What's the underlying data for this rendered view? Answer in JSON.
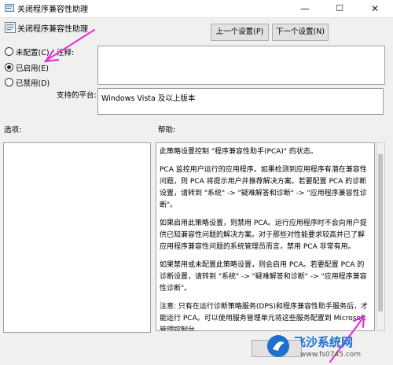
{
  "window": {
    "title": "关闭程序兼容性助理",
    "minimize": "—",
    "maximize": "☐",
    "close": "✕"
  },
  "header": {
    "policy_title": "关闭程序兼容性助理",
    "prev_button": "上一个设置(P)",
    "next_button": "下一个设置(N)"
  },
  "options": [
    {
      "label": "未配置(C)",
      "selected": false
    },
    {
      "label": "已启用(E)",
      "selected": true
    },
    {
      "label": "已禁用(D)",
      "selected": false
    }
  ],
  "comment": {
    "label": "注释:",
    "value": ""
  },
  "platform": {
    "label": "支持的平台:",
    "value": "Windows Vista 及以上版本"
  },
  "sections": {
    "options_label": "选项:",
    "help_label": "帮助:"
  },
  "help": {
    "paragraphs": [
      "此策略设置控制 \"程序兼容性助手(PCA)\" 的状态。",
      "PCA 监控用户运行的应用程序。如果检测到应用程序有潜在兼容性问题，则 PCA 将提示用户并推荐解决方案。若要配置 PCA 的诊断设置，请转到 \"系统\" -> \"疑难解答和诊断\" -> \"应用程序兼容性诊断\"。",
      "如果启用此策略设置，则禁用 PCA。运行应用程序时不会向用户提供已知兼容性问题的解决方案。对于那些对性能要求较高并已了解应用程序兼容性问题的系统管理员而言，禁用 PCA 非常有用。",
      "如果禁用或未配置此策略设置，则会启用 PCA。若要配置 PCA 的诊断设置，请转到 \"系统\" -> \"疑难解答和诊断\" -> \"应用程序兼容性诊断\"。",
      "注意: 只有在运行诊断策略服务(DPS)和程序兼容性助手服务后，才能运行 PCA。可以使用服务管理单元将这些服务配置到 Microsoft 管理控制台。"
    ]
  },
  "watermark": {
    "brand": "飞沙系统网",
    "url": "www.fs0745.com"
  },
  "colors": {
    "annotation_arrow": "#e233d8",
    "watermark_blue": "#1e6fd1"
  }
}
